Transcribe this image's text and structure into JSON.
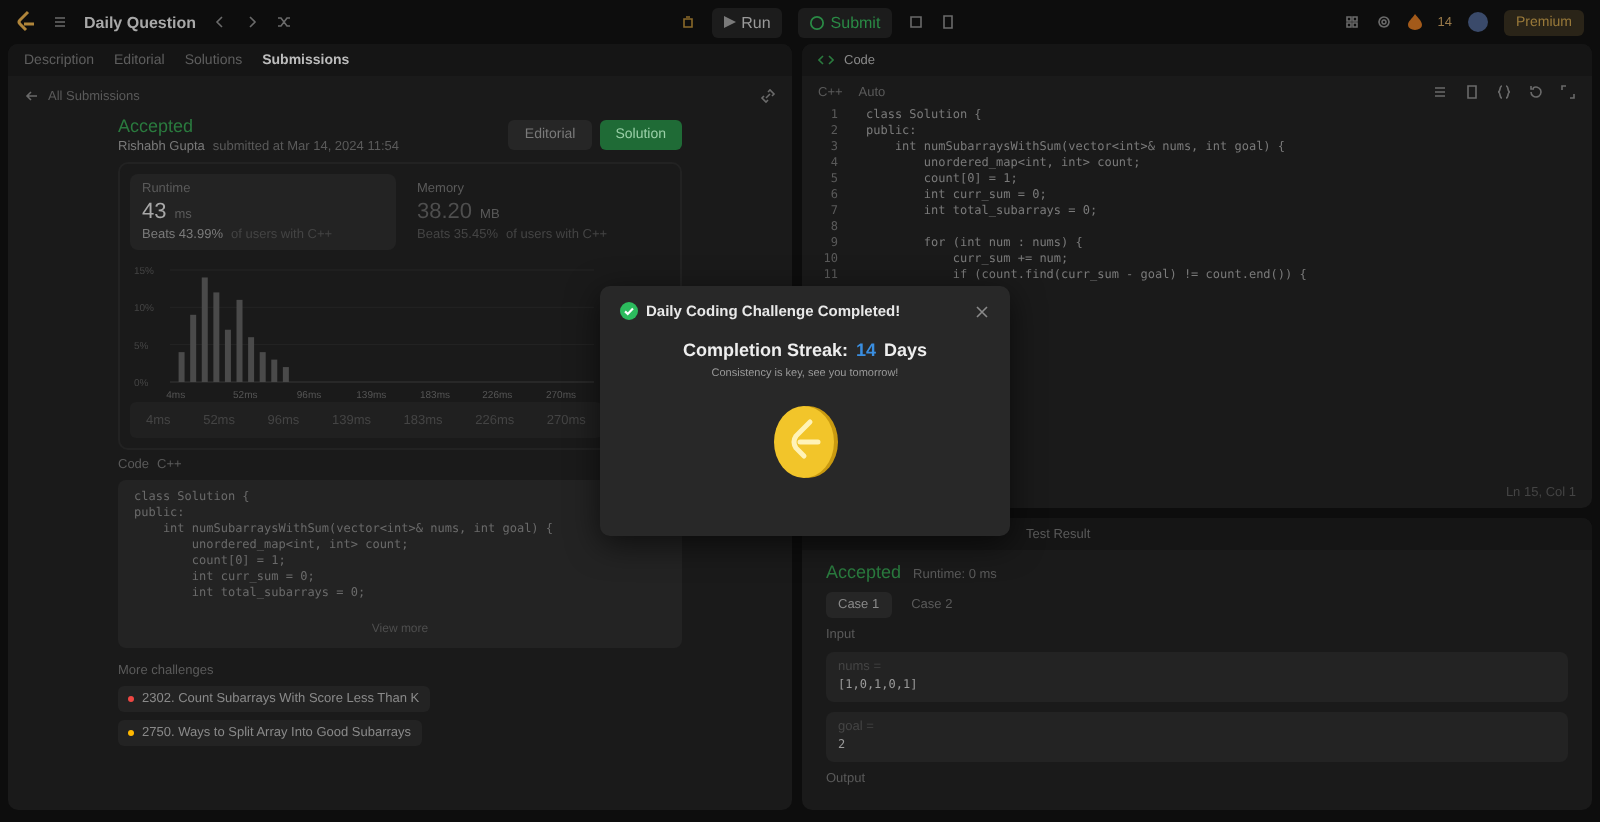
{
  "topbar": {
    "title": "Daily Question",
    "run": "Run",
    "submit": "Submit",
    "streak": "14",
    "premium": "Premium"
  },
  "left_tabs": [
    {
      "label": "Description",
      "selected": false
    },
    {
      "label": "Editorial",
      "selected": false
    },
    {
      "label": "Solutions",
      "selected": false
    },
    {
      "label": "Submissions",
      "selected": true
    }
  ],
  "back_link": "All Submissions",
  "submission": {
    "status": "Accepted",
    "author": "Rishabh Gupta",
    "submitted": "submitted at Mar 14, 2024 11:54",
    "editorial_button": "Editorial",
    "solution_button": "Solution"
  },
  "stats": [
    {
      "label": "Runtime",
      "value": "43",
      "unit": "ms",
      "beats": "Beats 43.99%",
      "rest": "of users with C++",
      "selected": true
    },
    {
      "label": "Memory",
      "value": "38.20",
      "unit": "MB",
      "beats": "Beats 35.45%",
      "rest": "of users with C++",
      "selected": false
    }
  ],
  "chart_data": {
    "type": "bar",
    "x": [
      8,
      16,
      24,
      32,
      40,
      48,
      56,
      64,
      72,
      80
    ],
    "values": [
      4,
      9,
      14,
      12,
      7,
      11,
      6,
      4,
      3,
      2
    ],
    "xlim": [
      0,
      290
    ],
    "ylim": [
      0,
      15
    ],
    "yticks": [
      {
        "value": 0,
        "label": "0%"
      },
      {
        "value": 5,
        "label": "5%"
      },
      {
        "value": 10,
        "label": "10%"
      },
      {
        "value": 15,
        "label": "15%"
      }
    ],
    "xticks": [
      {
        "value": 4,
        "label": "4ms"
      },
      {
        "value": 52,
        "label": "52ms"
      },
      {
        "value": 96,
        "label": "96ms"
      },
      {
        "value": 139,
        "label": "139ms"
      },
      {
        "value": 183,
        "label": "183ms"
      },
      {
        "value": 226,
        "label": "226ms"
      },
      {
        "value": 270,
        "label": "270ms"
      }
    ]
  },
  "overview_labels": [
    "4ms",
    "52ms",
    "96ms",
    "139ms",
    "183ms",
    "226ms",
    "270ms"
  ],
  "code_section": {
    "label": "Code",
    "language": "C++",
    "view_more": "View more",
    "lines": [
      "class Solution {",
      "public:",
      "    int numSubarraysWithSum(vector<int>& nums, int goal) {",
      "        unordered_map<int, int> count;",
      "        count[0] = 1;",
      "        int curr_sum = 0;",
      "        int total_subarrays = 0;"
    ]
  },
  "more_challenges": {
    "title": "More challenges",
    "items": [
      {
        "label": "2302. Count Subarrays With Score Less Than K",
        "color": "#ef4743"
      },
      {
        "label": "2750. Ways to Split Array Into Good Subarrays",
        "color": "#ffb800"
      }
    ]
  },
  "editor": {
    "title": "Code",
    "language": "C++",
    "mode": "Auto",
    "status": "Ln 15, Col 1",
    "lines": [
      {
        "number": "1",
        "text": "class Solution {"
      },
      {
        "number": "2",
        "text": "public:"
      },
      {
        "number": "3",
        "text": "    int numSubarraysWithSum(vector<int>& nums, int goal) {"
      },
      {
        "number": "4",
        "text": "        unordered_map<int, int> count;"
      },
      {
        "number": "5",
        "text": "        count[0] = 1;"
      },
      {
        "number": "6",
        "text": "        int curr_sum = 0;"
      },
      {
        "number": "7",
        "text": "        int total_subarrays = 0;"
      },
      {
        "number": "8"
      },
      {
        "number": "9",
        "text": "        for (int num : nums) {"
      },
      {
        "number": "10",
        "text": "            curr_sum += num;"
      },
      {
        "number": "11",
        "text": "            if (count.find(curr_sum - goal) != count.end()) {"
      }
    ]
  },
  "result": {
    "tab": "Test Result",
    "status": "Accepted",
    "runtime": "Runtime: 0 ms",
    "cases": [
      {
        "label": "Case 1",
        "selected": true
      },
      {
        "label": "Case 2",
        "selected": false
      }
    ],
    "input_label": "Input",
    "params": [
      {
        "name": "nums =",
        "value": "[1,0,1,0,1]"
      },
      {
        "name": "goal =",
        "value": "2"
      }
    ],
    "output_label": "Output"
  },
  "modal": {
    "title": "Daily Coding Challenge Completed!",
    "streak_label": "Completion Streak:",
    "streak": "14",
    "days": "Days",
    "message": "Consistency is key, see you tomorrow!"
  }
}
